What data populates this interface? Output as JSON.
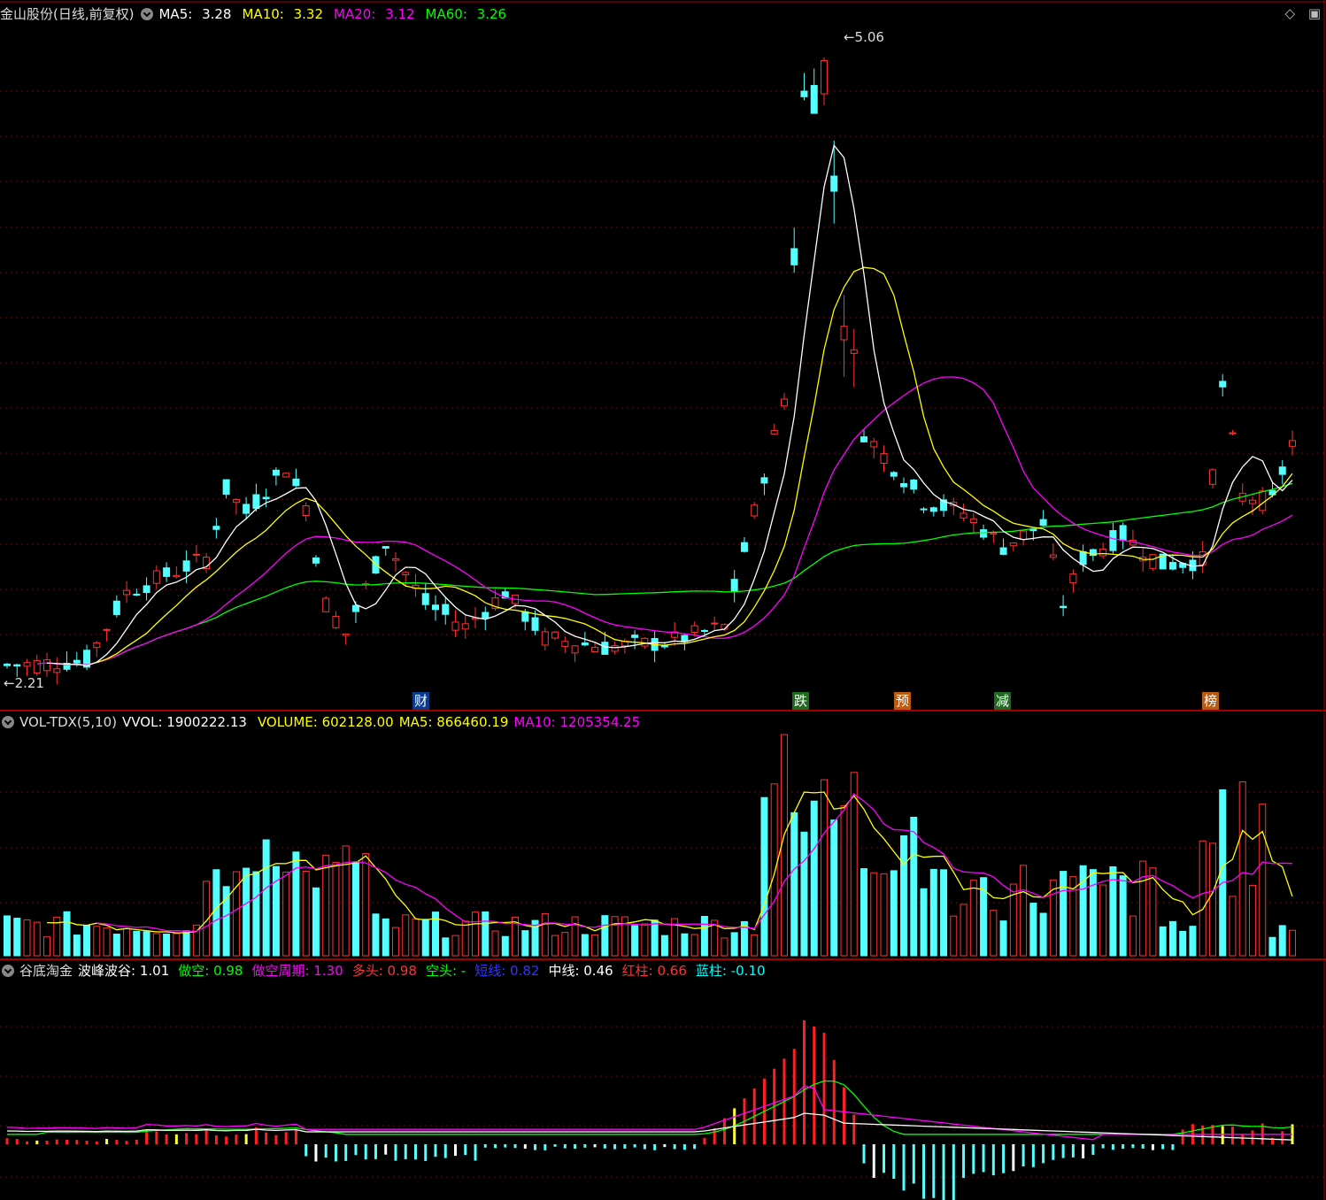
{
  "panel1": {
    "title": "金山股份(日线,前复权)",
    "ma5": {
      "label": "MA5:",
      "value": "3.28",
      "color": "#ffffff"
    },
    "ma10": {
      "label": "MA10:",
      "value": "3.32",
      "color": "#ffff00"
    },
    "ma20": {
      "label": "MA20:",
      "value": "3.12",
      "color": "#ff00ff"
    },
    "ma60": {
      "label": "MA60:",
      "value": "3.26",
      "color": "#00ff00"
    },
    "high_label": "5.06",
    "low_label": "2.21",
    "markers": [
      {
        "text": "财",
        "bg": "#0a3a8a",
        "fg": "#ffffff"
      },
      {
        "text": "跌",
        "bg": "#1e6a1e",
        "fg": "#ffffff"
      },
      {
        "text": "预",
        "bg": "#b85a10",
        "fg": "#ffffff"
      },
      {
        "text": "减",
        "bg": "#1e6a1e",
        "fg": "#ffffff"
      },
      {
        "text": "榜",
        "bg": "#b85a10",
        "fg": "#ffffff"
      }
    ]
  },
  "panel2": {
    "title": "VOL-TDX(5,10)",
    "vvol": "VVOL: 1900222.13",
    "volume": "VOLUME: 602128.00",
    "ma5": "MA5: 866460.19",
    "ma10": "MA10: 1205354.25"
  },
  "panel3": {
    "title": "谷底淘金",
    "items": [
      {
        "label": "波峰波谷:",
        "value": "1.01",
        "color": "#ffffff"
      },
      {
        "label": "做空:",
        "value": "0.98",
        "color": "#00ff00"
      },
      {
        "label": "做空周期:",
        "value": "1.30",
        "color": "#ff00ff"
      },
      {
        "label": "多头:",
        "value": "0.98",
        "color": "#ff3333"
      },
      {
        "label": "空头:",
        "value": "-",
        "color": "#00ff00"
      },
      {
        "label": "短线:",
        "value": "0.82",
        "color": "#3333ff"
      },
      {
        "label": "中线:",
        "value": "0.46",
        "color": "#ffffff"
      },
      {
        "label": "红柱:",
        "value": "0.66",
        "color": "#ff3333"
      },
      {
        "label": "蓝柱:",
        "value": "-0.10",
        "color": "#00ffff"
      }
    ]
  },
  "chart_data": {
    "type": "candlestick",
    "price_range": [
      2.21,
      5.06
    ],
    "colors": {
      "up": "#ff3232",
      "down": "#54ffff",
      "ma5": "#ffffff",
      "ma10": "#ffff00",
      "ma20": "#ff00ff",
      "ma60": "#00ff00"
    }
  }
}
